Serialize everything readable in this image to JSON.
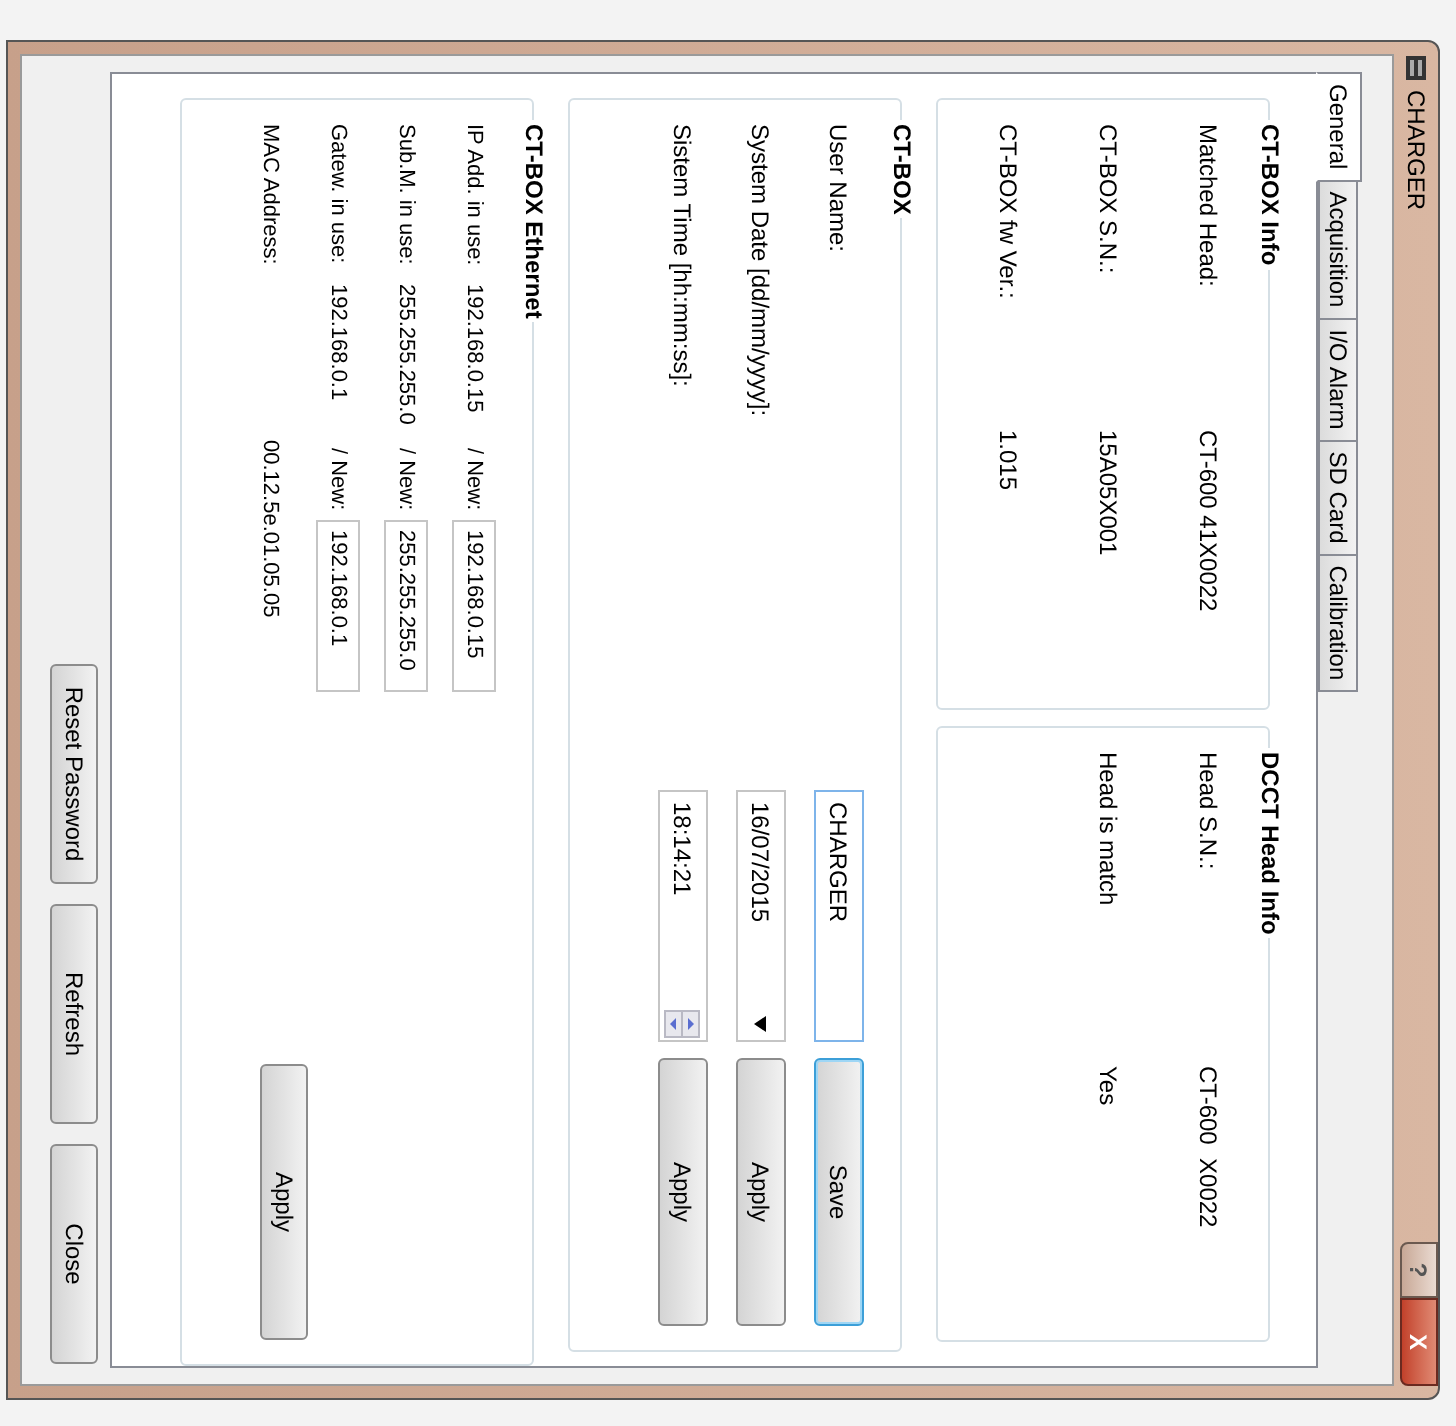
{
  "window": {
    "title": "CHARGER",
    "buttons": [
      "?",
      "X"
    ]
  },
  "tabs": [
    {
      "label": "General",
      "selected": true
    },
    {
      "label": "Acquisition",
      "selected": false
    },
    {
      "label": "I/O Alarm",
      "selected": false
    },
    {
      "label": "SD Card",
      "selected": false
    },
    {
      "label": "Calibration",
      "selected": false
    }
  ],
  "ctbox_info": {
    "title": "CT-BOX Info",
    "rows": [
      {
        "label": "Matched Head:",
        "value": "CT-600 41X0022"
      },
      {
        "label": "CT-BOX S.N.:",
        "value": "15A05X001"
      },
      {
        "label": "CT-BOX fw Ver.:",
        "value": "1.015"
      }
    ]
  },
  "dcct_head_info": {
    "title": "DCCT Head Info",
    "rows": [
      {
        "label": "Head S.N.:",
        "value": "CT-600  X0022"
      },
      {
        "label": "Head is match",
        "value": "Yes"
      }
    ]
  },
  "ctbox": {
    "title": "CT-BOX",
    "rows": [
      {
        "kind": "text",
        "label": "User Name:",
        "value": "CHARGER",
        "button": "Save",
        "focused": true
      },
      {
        "kind": "date",
        "label": "System Date [dd/mm/yyyy]:",
        "value": "16/07/2015",
        "button": "Apply",
        "focused": false
      },
      {
        "kind": "time",
        "label": "Sistem Time [hh:mm:ss]:",
        "value": "18:14:21",
        "button": "Apply",
        "focused": false
      }
    ]
  },
  "ethernet": {
    "title": "CT-BOX Ethernet",
    "rows": [
      {
        "kind": "editable",
        "label": "IP Add. in use:",
        "in_use": "192.168.0.15",
        "new_label": "/ New:",
        "new_value": "192.168.0.15"
      },
      {
        "kind": "editable",
        "label": "Sub.M. in use:",
        "in_use": "255.255.255.0",
        "new_label": "/ New:",
        "new_value": "255.255.255.0"
      },
      {
        "kind": "editable",
        "label": "Gatew. in use:",
        "in_use": "192.168.0.1",
        "new_label": "/ New:",
        "new_value": "192.168.0.1"
      },
      {
        "kind": "readonly",
        "label": "MAC Address:",
        "value": "00.12.5e.01.05.05"
      }
    ],
    "button": "Apply"
  },
  "footer_buttons": [
    "Reset Password",
    "Refresh",
    "Close"
  ]
}
